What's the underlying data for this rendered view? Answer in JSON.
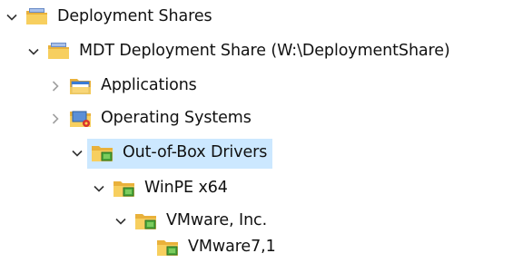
{
  "tree": {
    "items": [
      {
        "label": "Deployment Shares",
        "state": "expanded",
        "icon": "folder-shares-icon"
      },
      {
        "label": "MDT Deployment Share (W:\\DeploymentShare)",
        "state": "expanded",
        "icon": "folder-deployment-share-icon"
      },
      {
        "label": "Applications",
        "state": "collapsed",
        "icon": "folder-applications-icon"
      },
      {
        "label": "Operating Systems",
        "state": "collapsed",
        "icon": "folder-operating-systems-icon"
      },
      {
        "label": "Out-of-Box Drivers",
        "state": "expanded",
        "selected": true,
        "icon": "folder-drivers-icon"
      },
      {
        "label": "WinPE x64",
        "state": "expanded",
        "icon": "folder-drivers-icon"
      },
      {
        "label": "VMware, Inc.",
        "state": "expanded",
        "icon": "folder-drivers-icon"
      },
      {
        "label": "VMware7,1",
        "state": "leaf",
        "icon": "folder-drivers-icon"
      }
    ]
  },
  "colors": {
    "selection": "#cce8ff",
    "folder": "#f2c14e",
    "folder_dark": "#d99a1f",
    "chevron": "#333333",
    "chevron_collapsed": "#a0a0a0",
    "driver_green": "#4aa83a"
  }
}
